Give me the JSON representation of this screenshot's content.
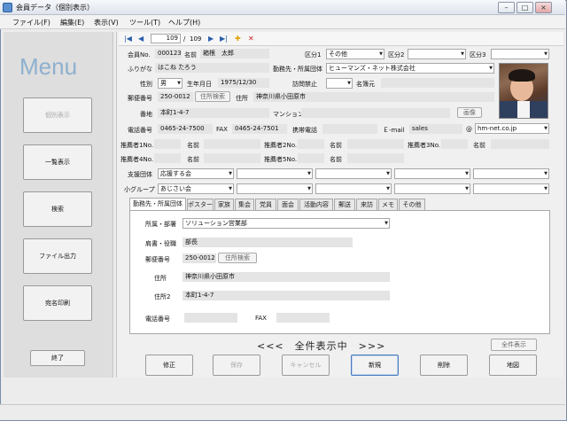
{
  "window": {
    "title": "会員データ（個別表示）",
    "min": "–",
    "max": "□",
    "close": "×"
  },
  "menubar": [
    "ファイル(F)",
    "編集(E)",
    "表示(V)",
    "ツール(T)",
    "ヘルプ(H)"
  ],
  "sidebar": {
    "title": "Menu",
    "buttons": [
      {
        "label": "個別表示",
        "enabled": false
      },
      {
        "label": "一覧表示",
        "enabled": true
      },
      {
        "label": "検索",
        "enabled": true
      },
      {
        "label": "ファイル出力",
        "enabled": true
      },
      {
        "label": "宛名印刷",
        "enabled": true
      }
    ],
    "exit": "終了"
  },
  "nav": {
    "record": "109",
    "sep": "/",
    "total": "109",
    "first": "|◀",
    "prev": "◀",
    "next": "▶",
    "last": "▶|",
    "add": "✚",
    "del": "✕"
  },
  "form": {
    "member_no_label": "会員No.",
    "member_no": "000123",
    "name_label": "名前",
    "name": "箱根　太郎",
    "kubun1_label": "区分1",
    "kubun1": "その他",
    "kubun2_label": "区分2",
    "kubun2": "",
    "kubun3_label": "区分3",
    "kubun3": "",
    "kana_label": "ふりがな",
    "kana": "はこね たろう",
    "org_label": "勤務先・所属団体",
    "org": "ヒューマンズ・ネット株式会社",
    "sex_label": "性別",
    "sex": "男",
    "birth_label": "生年月日",
    "birth": "1975/12/30",
    "visit_label": "訪問禁止",
    "visit": "",
    "meibo_label": "名簿元",
    "meibo": "",
    "zip_label": "郵便番号",
    "zip": "250-0012",
    "zip_btn": "住所検索",
    "addr_label": "住所",
    "addr": "神奈川県小田原市",
    "banchi_label": "番地",
    "banchi": "本町1-4-7",
    "mansion_label": "マンション",
    "mansion": "",
    "image_btn": "画像",
    "tel_label": "電話番号",
    "tel": "0465-24-7500",
    "fax_label": "FAX",
    "fax": "0465-24-7501",
    "mobile_label": "携帯電話",
    "mobile": "",
    "email_label": "Ｅ-mail",
    "email_user": "sales",
    "email_at": "@",
    "email_domain": "hm-net.co.jp",
    "rec1_label": "推薦者1No.",
    "rec2_label": "推薦者2No.",
    "rec3_label": "推薦者3No.",
    "rec4_label": "推薦者4No.",
    "rec5_label": "推薦者5No.",
    "rec_name_label": "名前",
    "support_label": "支援団体",
    "support1": "応援する会",
    "small_label": "小グループ",
    "small1": "あじさい会"
  },
  "tabs": [
    "勤務先・所属団体",
    "ポスター",
    "家族",
    "集会",
    "党員",
    "面会",
    "活動内容",
    "郵送",
    "来訪",
    "メモ",
    "その他"
  ],
  "tabpanel": {
    "dept_label": "所属・部署",
    "dept": "ソリューション営業部",
    "title_label": "肩書・役職",
    "title": "部長",
    "zip_label": "郵便番号",
    "zip": "250-0012",
    "zip_btn": "住所検索",
    "addr_label": "住所",
    "addr": "神奈川県小田原市",
    "addr2_label": "住所2",
    "addr2": "本町1-4-7",
    "tel_label": "電話番号",
    "tel": "",
    "fax_label": "FAX",
    "fax": ""
  },
  "status_text": "<<<　全件表示中　>>>",
  "show_all_btn": "全件表示",
  "bottom_buttons": [
    {
      "label": "修正",
      "enabled": true
    },
    {
      "label": "保存",
      "enabled": false
    },
    {
      "label": "キャンセル",
      "enabled": false
    },
    {
      "label": "新規",
      "enabled": true
    },
    {
      "label": "削除",
      "enabled": true
    },
    {
      "label": "地図",
      "enabled": true
    }
  ],
  "colors": {
    "accent": "#2a5fa8",
    "menu_title": "#8fb0cf",
    "add": "#e0a000",
    "delete": "#d02020"
  }
}
